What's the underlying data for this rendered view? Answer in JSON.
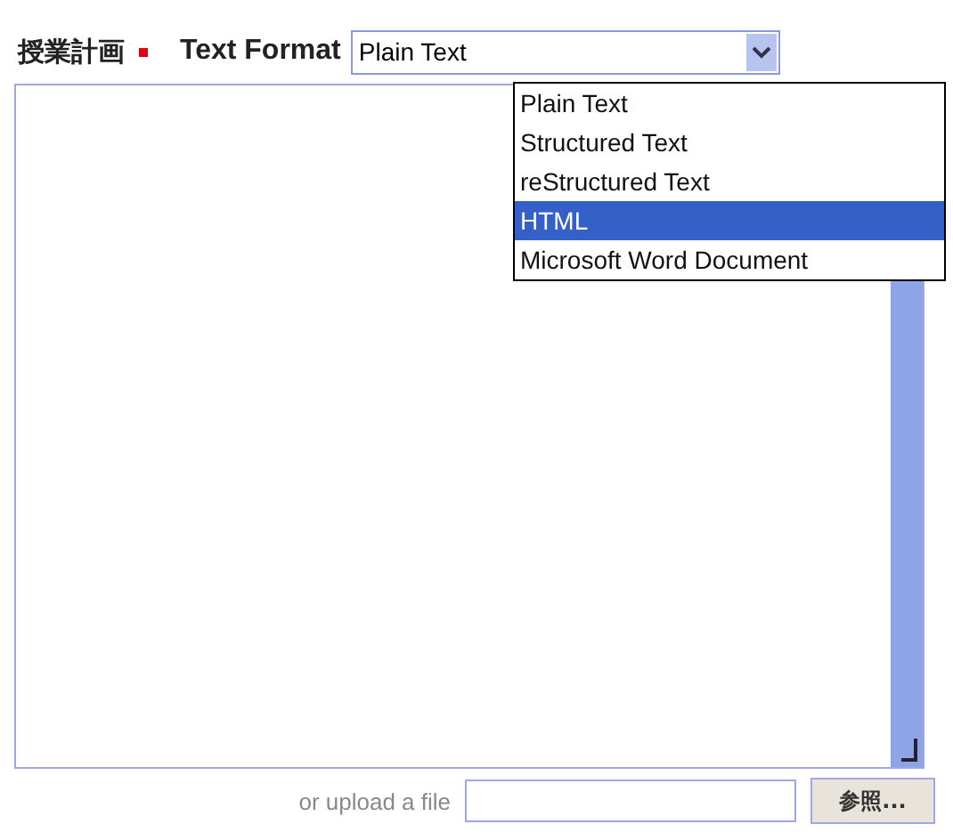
{
  "field_label": "授業計画",
  "required": true,
  "text_format": {
    "label": "Text Format",
    "value": "Plain Text",
    "open": true,
    "options": [
      {
        "label": "Plain Text",
        "highlighted": false
      },
      {
        "label": "Structured Text",
        "highlighted": false
      },
      {
        "label": "reStructured Text",
        "highlighted": false
      },
      {
        "label": "HTML",
        "highlighted": true
      },
      {
        "label": "Microsoft Word Document",
        "highlighted": false
      }
    ]
  },
  "upload": {
    "label": "or upload a file",
    "button": "参照..."
  }
}
